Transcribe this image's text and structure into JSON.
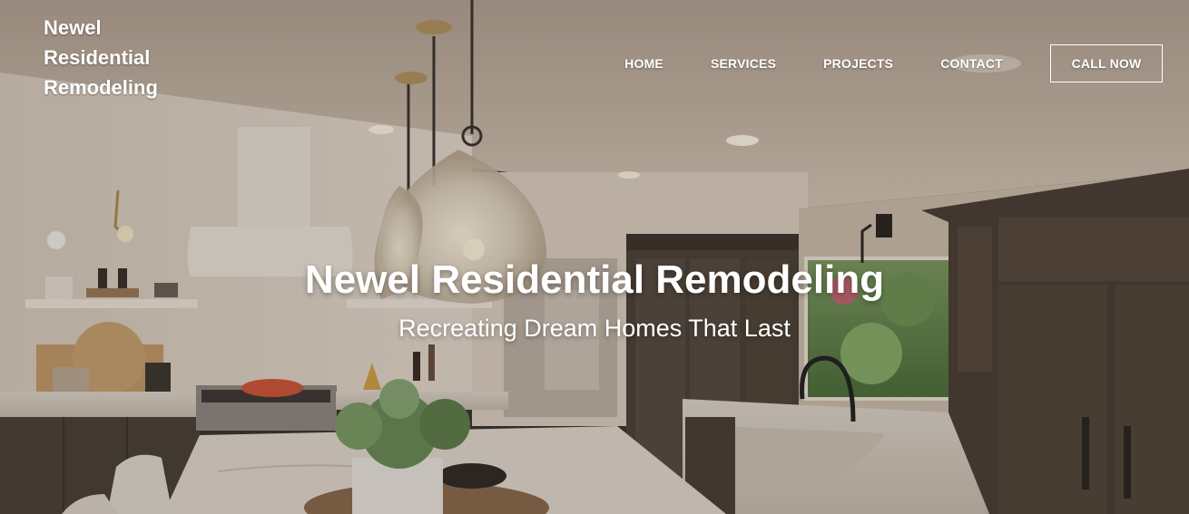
{
  "brand": {
    "line1": "Newel",
    "line2": "Residential",
    "line3": "Remodeling"
  },
  "nav": {
    "items": [
      {
        "label": "HOME"
      },
      {
        "label": "SERVICES"
      },
      {
        "label": "PROJECTS"
      },
      {
        "label": "CONTACT"
      }
    ],
    "cta_label": "CALL NOW"
  },
  "hero": {
    "title": "Newel Residential Remodeling",
    "subtitle": "Recreating Dream Homes That Last",
    "background_image": "kitchen-interior-photo"
  },
  "colors": {
    "text": "#ffffff",
    "cabinet_dark": "#4a3f35",
    "ceiling": "#c9b8a6"
  }
}
